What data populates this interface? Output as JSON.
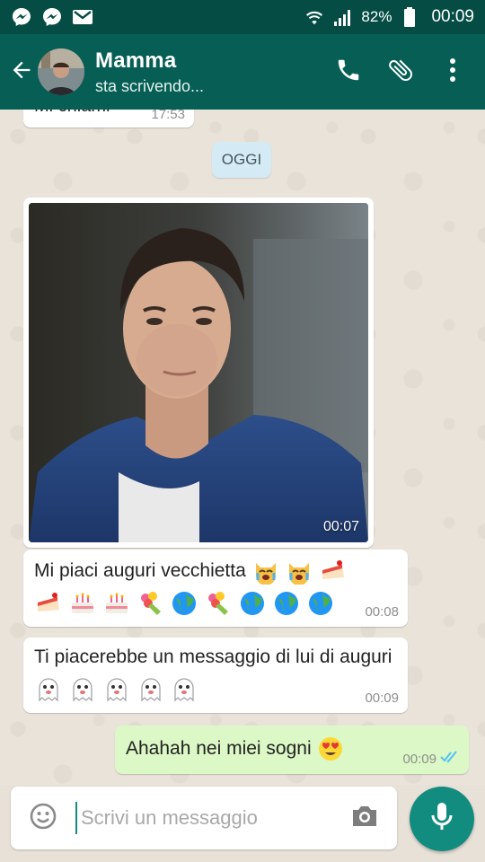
{
  "statusbar": {
    "battery": "82%",
    "time": "00:09"
  },
  "header": {
    "title": "Mamma",
    "subtitle": "sta scrivendo..."
  },
  "chat": {
    "previous_message": {
      "text": "Mi chiami",
      "time": "17:53"
    },
    "date_chip": "OGGI",
    "messages": [
      {
        "type": "image",
        "time": "00:07"
      },
      {
        "type": "text",
        "text": "Mi piaci auguri vecchietta",
        "time": "00:08"
      },
      {
        "type": "text",
        "text": "Ti piacerebbe un messaggio di lui di auguri",
        "time": "00:09"
      },
      {
        "type": "text",
        "direction": "outgoing",
        "text": "Ahahah nei miei sogni",
        "time": "00:09",
        "status": "read"
      }
    ]
  },
  "composer": {
    "placeholder": "Scrivi un messaggio"
  },
  "colors": {
    "header": "#075e54",
    "statusbar": "#054d44",
    "accent": "#128c7e",
    "outgoing_bubble": "#dcf8c6",
    "read_tick": "#4fc3f7"
  },
  "icons": [
    "messenger-icon",
    "messenger-icon",
    "gmail-icon",
    "wifi-icon",
    "signal-icon",
    "battery-icon",
    "back-arrow-icon",
    "phone-icon",
    "paperclip-icon",
    "more-vert-icon",
    "emoji-icon",
    "camera-icon",
    "mic-icon",
    "double-check-icon"
  ]
}
